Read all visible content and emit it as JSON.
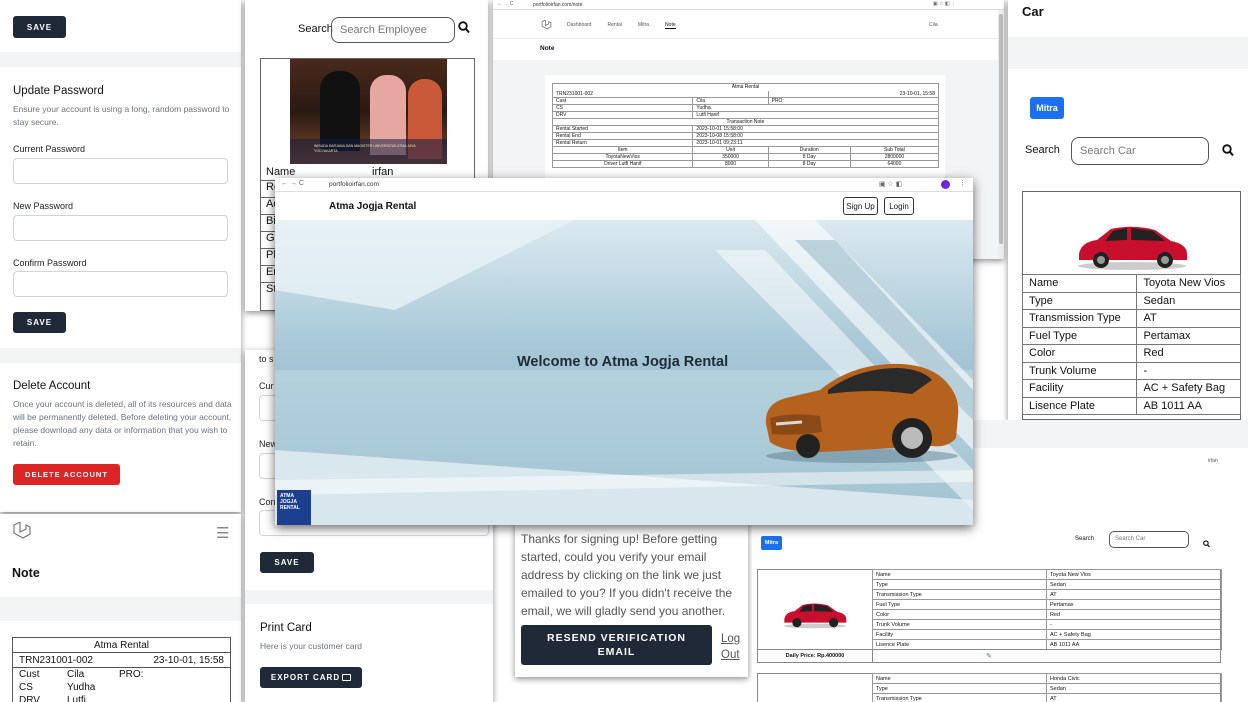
{
  "profile": {
    "save": "SAVE",
    "update_title": "Update Password",
    "update_desc": "Ensure your account is using a long, random password to stay secure.",
    "current_label": "Current Password",
    "new_label": "New Password",
    "confirm_label": "Confirm Password",
    "delete_title": "Delete Account",
    "delete_desc": "Once your account is deleted, all of its resources and data will be permanently deleted. Before deleting your account, please download any data or information that you wish to retain.",
    "delete_btn": "DELETE ACCOUNT"
  },
  "note_mobile": {
    "title": "Note",
    "company": "Atma Rental",
    "trn": "TRN231001-002",
    "date": "23-10-01, 15:58",
    "rows": [
      [
        "Cust",
        "Cila",
        "PRO:"
      ],
      [
        "CS",
        "Yudha",
        ""
      ],
      [
        "DRV",
        "Lutfi",
        ""
      ]
    ]
  },
  "employee": {
    "search_label": "Search",
    "search_placeholder": "Search Employee",
    "name_label": "Name",
    "name_value": "irfan",
    "row_initials": [
      "Ro",
      "Ad",
      "Bi",
      "Ge",
      "Ph",
      "Em",
      "St"
    ],
    "photo_caption": "WISUDA SARJANA DAN MAGISTER UNIVERSITAS ATMA JAYA YOGYAKARTA"
  },
  "customer": {
    "trunc_text": "to s",
    "labels": [
      "Cur",
      "New",
      "Con"
    ],
    "save": "SAVE",
    "print_title": "Print Card",
    "print_desc": "Here is your customer card",
    "export": "EXPORT CARD"
  },
  "note_desktop": {
    "url": "portfolioirfan.com/note",
    "nav": [
      "Dashboard",
      "Rental",
      "Mitra",
      "Note"
    ],
    "user": "Cila",
    "title": "Note",
    "company": "Atma Rental",
    "trn": "TRN231001-002",
    "date": "23-10-01, 15:58",
    "info": [
      [
        "Cust",
        "Cila",
        "PRO:"
      ],
      [
        "CS",
        "Yudha",
        ""
      ],
      [
        "DRV",
        "Lutfi Hanif",
        ""
      ]
    ],
    "section": "Transaction Note",
    "dates": [
      [
        "Rental Started",
        "2023-10-01 15:58:00"
      ],
      [
        "Rental End",
        "2023-10-08 15:58:00"
      ],
      [
        "Rental Return",
        "2023-10-01 09:23:11"
      ]
    ],
    "headers": [
      "Item",
      "Unit",
      "Duration",
      "Sub Total"
    ],
    "items": [
      [
        "ToyotaNewVios",
        "350000",
        "8 Day",
        "2800000"
      ],
      [
        "Driver Lutfi Hanif",
        "8000",
        "8 Day",
        "64000"
      ]
    ]
  },
  "car_detail": {
    "heading": "Car",
    "mitra": "Mitra",
    "search_label": "Search",
    "search_placeholder": "Search Car",
    "rows": [
      [
        "Name",
        "Toyota New Vios"
      ],
      [
        "Type",
        "Sedan"
      ],
      [
        "Transmission Type",
        "AT"
      ],
      [
        "Fuel Type",
        "Pertamax"
      ],
      [
        "Color",
        "Red"
      ],
      [
        "Trunk Volume",
        "-"
      ],
      [
        "Facility",
        "AC + Safety Bag"
      ],
      [
        "Lisence Plate",
        "AB 1011 AA"
      ]
    ],
    "next_label": "Daily Price"
  },
  "home": {
    "url": "portfolioirfan.com",
    "brand": "Atma Jogja Rental",
    "signup": "Sign Up",
    "login": "Login",
    "welcome": "Welcome to Atma Jogja Rental",
    "logo_lines": [
      "ATMA",
      "JOGJA",
      "RENTAL"
    ]
  },
  "verify": {
    "text": "Thanks for signing up! Before getting started, could you verify your email address by clicking on the link we just emailed to you? If you didn't receive the email, we will gladly send you another.",
    "resend": "RESEND VERIFICATION EMAIL",
    "logout": "Log Out"
  },
  "car_list": {
    "user": "irfan",
    "mitra": "Mitra",
    "search_label": "Search",
    "search_placeholder": "Search Car",
    "car1": [
      [
        "Name",
        "Toyota New Vios"
      ],
      [
        "Type",
        "Sedan"
      ],
      [
        "Transmission Type",
        "AT"
      ],
      [
        "Fuel Type",
        "Pertamax"
      ],
      [
        "Color",
        "Red"
      ],
      [
        "Trunk Volume",
        "-"
      ],
      [
        "Facility",
        "AC + Safety Bag"
      ],
      [
        "Lisence Plate",
        "AB 1011 AA"
      ]
    ],
    "price1": "Daily Price: Rp.400000",
    "car2": [
      [
        "Name",
        "Honda Civic"
      ],
      [
        "Type",
        "Sedan"
      ],
      [
        "Transmission Type",
        "AT"
      ]
    ]
  },
  "colors": {
    "dark_button": "#1f2937",
    "danger": "#dc2626",
    "mitra_blue": "#1d6ff2",
    "sky": "#b9d6e4"
  }
}
